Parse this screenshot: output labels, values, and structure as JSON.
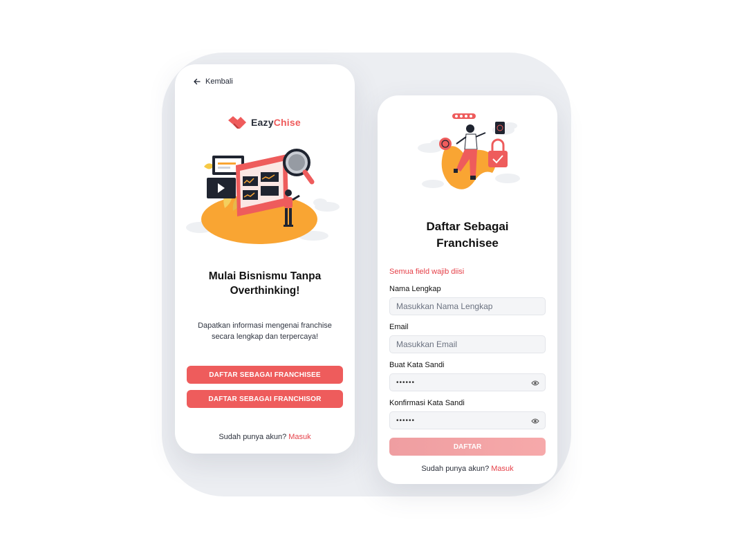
{
  "left_screen": {
    "back_label": "Kembali",
    "logo": {
      "part1": "Eazy",
      "part2": "Chise"
    },
    "heading_line1": "Mulai Bisnismu Tanpa",
    "heading_line2": "Overthinking!",
    "subtitle_line1": "Dapatkan informasi mengenai franchise",
    "subtitle_line2": "secara lengkap dan terpercaya!",
    "button_franchisee": "DAFTAR SEBAGAI FRANCHISEE",
    "button_franchisor": "DAFTAR SEBAGAI FRANCHISOR",
    "login_prompt": "Sudah punya akun?",
    "login_link": "Masuk"
  },
  "right_screen": {
    "heading_line1": "Daftar Sebagai",
    "heading_line2": "Franchisee",
    "required_note": "Semua field wajib diisi",
    "fields": [
      {
        "label": "Nama Lengkap",
        "placeholder": "Masukkan Nama Lengkap"
      },
      {
        "label": "Email",
        "placeholder": "Masukkan Email"
      },
      {
        "label": "Buat Kata Sandi",
        "value": "••••••"
      },
      {
        "label": "Konfirmasi Kata Sandi",
        "value": "••••••"
      }
    ],
    "submit_label": "DAFTAR",
    "login_prompt": "Sudah punya akun?",
    "login_link": "Masuk"
  },
  "colors": {
    "accent": "#ee5c5c",
    "link": "#e53f47",
    "illustration_orange": "#f9a533",
    "backdrop": "#eceef2"
  }
}
